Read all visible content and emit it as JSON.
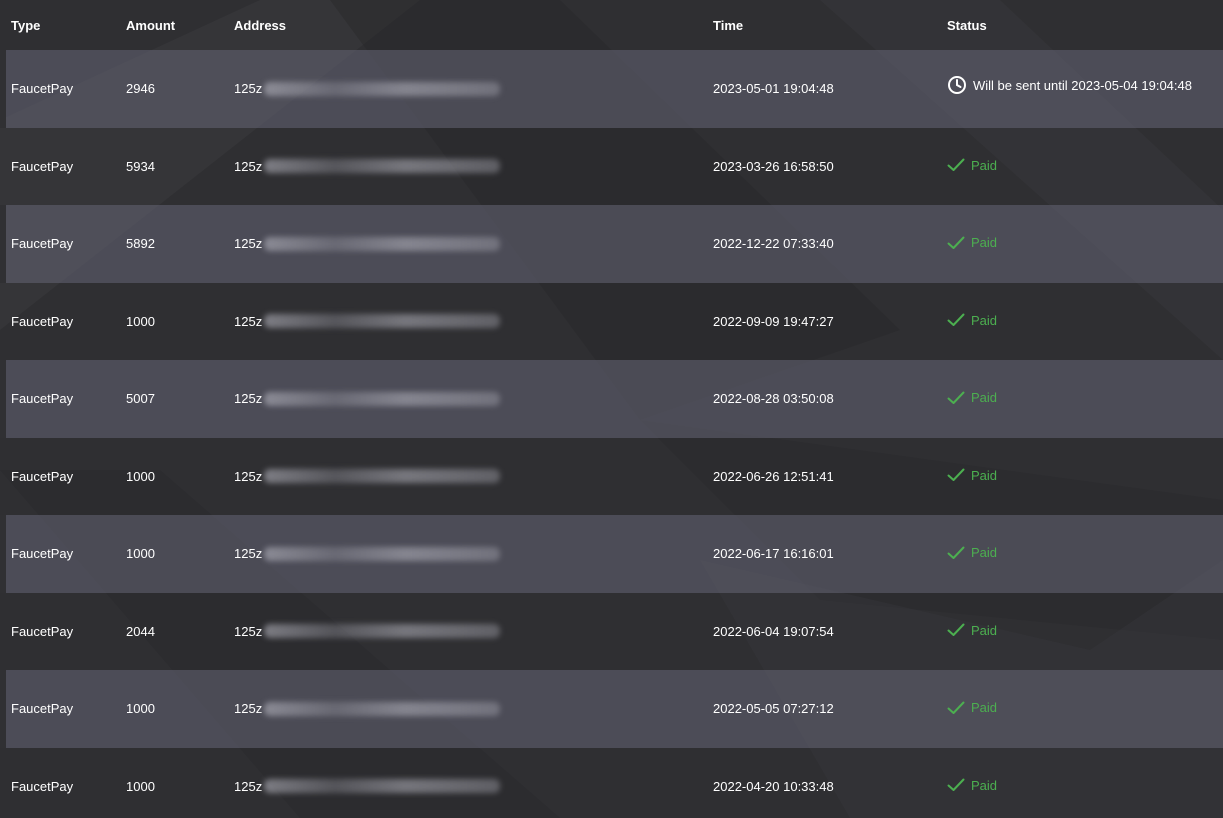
{
  "table": {
    "headers": {
      "type": "Type",
      "amount": "Amount",
      "address": "Address",
      "time": "Time",
      "status": "Status"
    },
    "rows": [
      {
        "type": "FaucetPay",
        "amount": "2946",
        "address_prefix": "125z",
        "time": "2023-05-01 19:04:48",
        "status": "Will be sent until 2023-05-04 19:04:48",
        "status_kind": "pending",
        "icon": "clock-icon"
      },
      {
        "type": "FaucetPay",
        "amount": "5934",
        "address_prefix": "125z",
        "time": "2023-03-26 16:58:50",
        "status": "Paid",
        "status_kind": "paid",
        "icon": "check-icon"
      },
      {
        "type": "FaucetPay",
        "amount": "5892",
        "address_prefix": "125z",
        "time": "2022-12-22 07:33:40",
        "status": "Paid",
        "status_kind": "paid",
        "icon": "check-icon"
      },
      {
        "type": "FaucetPay",
        "amount": "1000",
        "address_prefix": "125z",
        "time": "2022-09-09 19:47:27",
        "status": "Paid",
        "status_kind": "paid",
        "icon": "check-icon"
      },
      {
        "type": "FaucetPay",
        "amount": "5007",
        "address_prefix": "125z",
        "time": "2022-08-28 03:50:08",
        "status": "Paid",
        "status_kind": "paid",
        "icon": "check-icon"
      },
      {
        "type": "FaucetPay",
        "amount": "1000",
        "address_prefix": "125z",
        "time": "2022-06-26 12:51:41",
        "status": "Paid",
        "status_kind": "paid",
        "icon": "check-icon"
      },
      {
        "type": "FaucetPay",
        "amount": "1000",
        "address_prefix": "125z",
        "time": "2022-06-17 16:16:01",
        "status": "Paid",
        "status_kind": "paid",
        "icon": "check-icon"
      },
      {
        "type": "FaucetPay",
        "amount": "2044",
        "address_prefix": "125z",
        "time": "2022-06-04 19:07:54",
        "status": "Paid",
        "status_kind": "paid",
        "icon": "check-icon"
      },
      {
        "type": "FaucetPay",
        "amount": "1000",
        "address_prefix": "125z",
        "time": "2022-05-05 07:27:12",
        "status": "Paid",
        "status_kind": "paid",
        "icon": "check-icon"
      },
      {
        "type": "FaucetPay",
        "amount": "1000",
        "address_prefix": "125z",
        "time": "2022-04-20 10:33:48",
        "status": "Paid",
        "status_kind": "paid",
        "icon": "check-icon"
      }
    ]
  },
  "colors": {
    "background": "#2f2f32",
    "stripe": "#4c4c55",
    "paid": "#4caf50",
    "text": "#ffffff"
  }
}
